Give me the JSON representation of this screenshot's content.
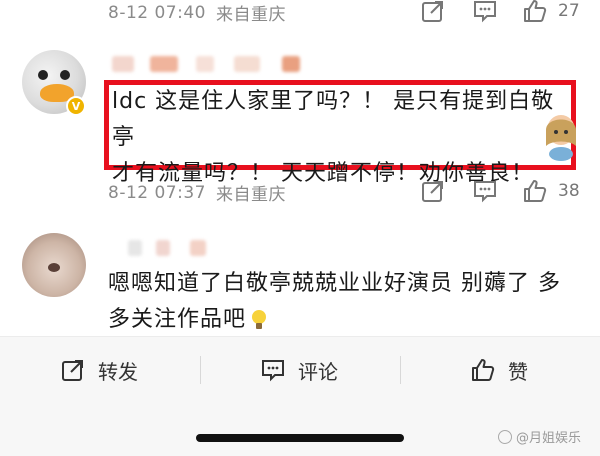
{
  "comments": [
    {
      "date": "8-12 07:40",
      "location": "来自重庆",
      "likes": "27"
    },
    {
      "text_line1": "ldc 这是住人家里了吗？！ 是只有提到白敬亭",
      "text_line2": "才有流量吗？！ 天天蹭不停！劝你善良！",
      "verified_badge": "V",
      "date": "8-12 07:37",
      "location": "来自重庆",
      "likes": "38"
    },
    {
      "text_line1": "嗯嗯知道了白敬亭兢兢业业好演员 别薅了 多",
      "text_line2": "多关注作品吧"
    }
  ],
  "bottom_bar": {
    "repost_label": "转发",
    "comment_label": "评论",
    "like_label": "赞"
  },
  "watermark": "@月姐娱乐",
  "colors": {
    "highlight_border": "#e8101e",
    "meta_text": "#8a8a8a",
    "verified_badge": "#f0b400"
  }
}
